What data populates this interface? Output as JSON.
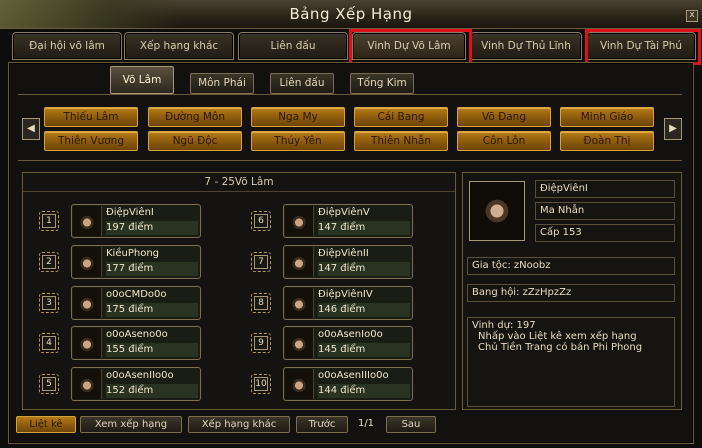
{
  "window": {
    "title": "Bảng Xếp Hạng",
    "close": "x"
  },
  "tabs": [
    "Đại hội võ lâm",
    "Xếp hạng khác",
    "Liên đấu",
    "Vinh Dự Võ Lâm",
    "Vinh Dự Thủ Lĩnh",
    "Vinh Dự Tài Phú"
  ],
  "subtabs": [
    "Võ Lâm",
    "Môn Phái",
    "Liên đấu",
    "Tống Kim"
  ],
  "nav": {
    "left": "◀",
    "right": "▶"
  },
  "factions": [
    "Thiếu Lâm",
    "Đường Môn",
    "Nga My",
    "Cái Bang",
    "Võ Đang",
    "Minh Giáo",
    "Thiên Vương",
    "Ngũ Độc",
    "Thúy Yên",
    "Thiên Nhẫn",
    "Côn Lôn",
    "Đoàn Thị"
  ],
  "list": {
    "header": "7 - 25Võ Lâm",
    "entries": [
      {
        "rank": "1",
        "name": "ĐiệpViênI",
        "score": "197 điểm"
      },
      {
        "rank": "2",
        "name": "KiềuPhong",
        "score": "177 điểm"
      },
      {
        "rank": "3",
        "name": "o0oCMDo0o",
        "score": "175 điểm"
      },
      {
        "rank": "4",
        "name": "o0oAseno0o",
        "score": "155 điểm"
      },
      {
        "rank": "5",
        "name": "o0oAsenIIo0o",
        "score": "152 điểm"
      },
      {
        "rank": "6",
        "name": "ĐiệpViênV",
        "score": "147 điểm"
      },
      {
        "rank": "7",
        "name": "ĐiệpViênII",
        "score": "147 điểm"
      },
      {
        "rank": "8",
        "name": "ĐiệpViênIV",
        "score": "146 điểm"
      },
      {
        "rank": "9",
        "name": "o0oAsenIo0o",
        "score": "145 điểm"
      },
      {
        "rank": "10",
        "name": "o0oAsenIIIo0o",
        "score": "144 điểm"
      }
    ]
  },
  "info": {
    "name": "ĐiệpViênI",
    "faction": "Ma Nhẫn",
    "level": "Cấp 153",
    "clan": "Gia tộc: zNoobz",
    "guild": "Bang hội: zZzHpzZz",
    "honor_line1": "Vinh dự: 197",
    "honor_line2": "Nhấp vào Liệt kê xem xếp hạng",
    "honor_line3": "Chủ Tiền Trang có bán Phi Phong"
  },
  "bottom": {
    "list": "Liệt kê",
    "view": "Xem xếp hạng",
    "other": "Xếp hạng khác",
    "prev": "Trước",
    "page": "1/1",
    "next": "Sau"
  },
  "colors": {
    "highlight": "#e0101a",
    "gold_button": "#b47a16"
  }
}
